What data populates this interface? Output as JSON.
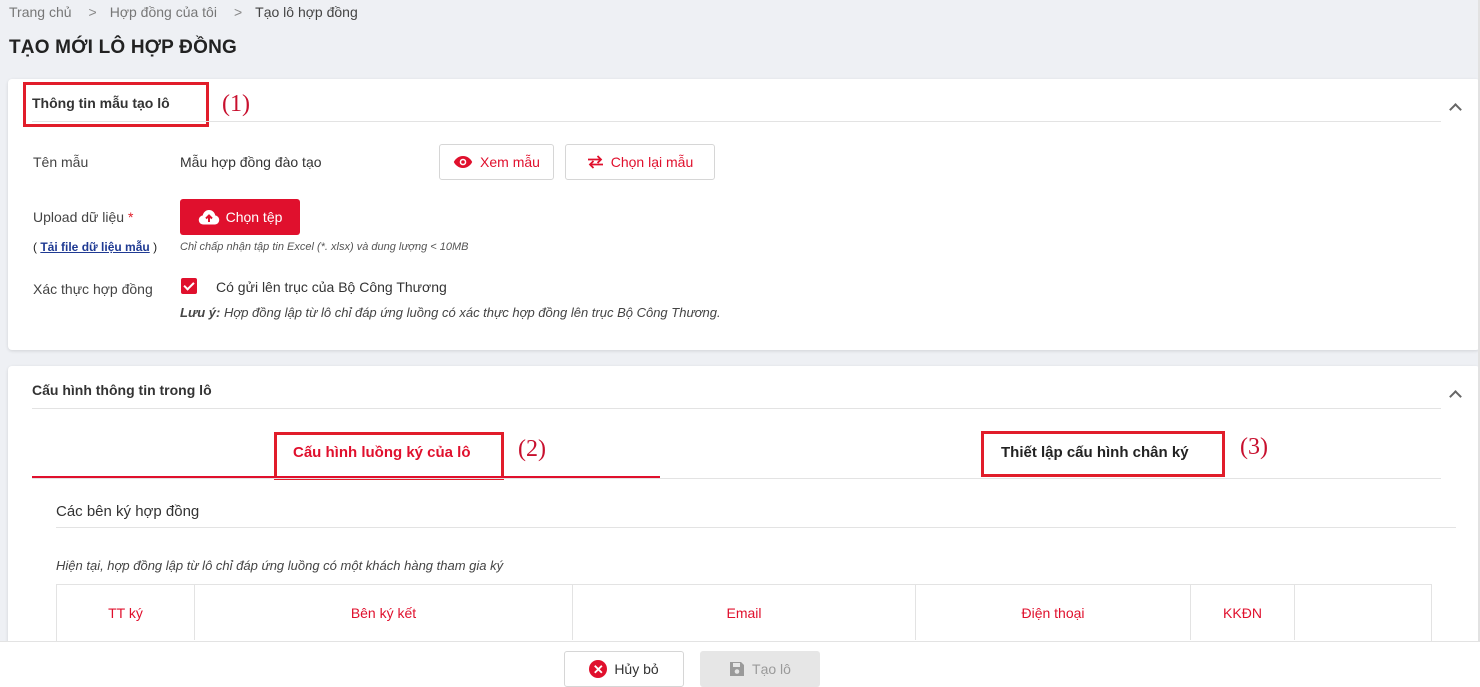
{
  "breadcrumb": {
    "home": "Trang chủ",
    "sep": ">",
    "contracts": "Hợp đồng của tôi",
    "current": "Tạo lô hợp đồng"
  },
  "page_title": "TẠO MỚI LÔ HỢP ĐỒNG",
  "section1": {
    "title": "Thông tin mẫu tạo lô",
    "marker": "(1)",
    "template_label": "Tên mẫu",
    "template_value": "Mẫu hợp đồng đào tạo",
    "view_button": "Xem mẫu",
    "rechoose_button": "Chọn lại mẫu",
    "upload_label": "Upload dữ liệu",
    "required_mark": "*",
    "choose_file_button": "Chọn tệp",
    "download_prefix": "(",
    "download_link": "Tải file dữ liệu mẫu",
    "download_suffix": ")",
    "upload_hint": "Chỉ chấp nhận tập tin Excel (*. xlsx) và dung lượng < 10MB",
    "verify_label": "Xác thực hợp đồng",
    "verify_checkbox_label": "Có gửi lên trục của Bộ Công Thương",
    "verify_checked": true,
    "note_prefix": "Lưu ý:",
    "note_text": " Hợp đồng lập từ lô chỉ đáp ứng luồng có xác thực hợp đồng lên trục Bộ Công Thương."
  },
  "section2": {
    "title": "Cấu hình thông tin trong lô",
    "tabs": [
      {
        "label": "Cấu hình luồng ký của lô",
        "marker": "(2)",
        "active": true
      },
      {
        "label": "Thiết lập cấu hình chân ký",
        "marker": "(3)",
        "active": false
      }
    ],
    "parties_title": "Các bên ký hợp đồng",
    "parties_note": "Hiện tại, hợp đồng lập từ lô chỉ đáp ứng luồng có một khách hàng tham gia ký",
    "table_headers": [
      "TT ký",
      "Bên ký kết",
      "Email",
      "Điện thoại",
      "KKĐN",
      ""
    ]
  },
  "footer": {
    "cancel_button": "Hủy bỏ",
    "create_button": "Tạo lô"
  },
  "colors": {
    "accent": "#e0102d",
    "annotation": "#e11d2a"
  }
}
